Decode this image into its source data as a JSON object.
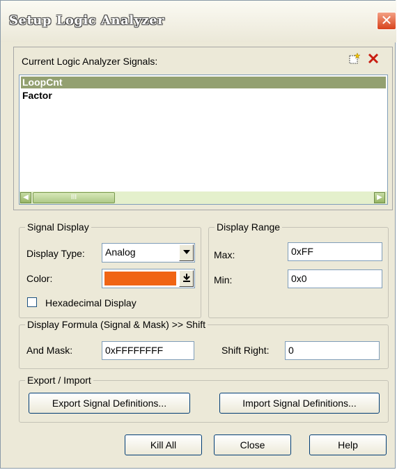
{
  "window": {
    "title": "Setup Logic Analyzer",
    "close_glyph": "✕"
  },
  "signals": {
    "label": "Current Logic Analyzer Signals:",
    "items": [
      "LoopCnt",
      "Factor"
    ],
    "selected_index": 0,
    "new_icon": "new-signal-icon",
    "delete_icon": "delete-signal-icon",
    "scroll_thumb_glyph": "III",
    "scroll_left_glyph": "◀",
    "scroll_right_glyph": "▶"
  },
  "signal_display": {
    "title": "Signal Display",
    "display_type_label": "Display Type:",
    "display_type_value": "Analog",
    "color_label": "Color:",
    "color_value": "#f06414",
    "hex_label": "Hexadecimal Display",
    "hex_checked": false
  },
  "display_range": {
    "title": "Display Range",
    "max_label": "Max:",
    "max_value": "0xFF",
    "min_label": "Min:",
    "min_value": "0x0"
  },
  "formula": {
    "title": "Display Formula (Signal & Mask) >> Shift",
    "and_mask_label": "And Mask:",
    "and_mask_value": "0xFFFFFFFF",
    "shift_right_label": "Shift Right:",
    "shift_right_value": "0"
  },
  "export_import": {
    "title": "Export / Import",
    "export_label": "Export Signal Definitions...",
    "import_label": "Import Signal Definitions..."
  },
  "buttons": {
    "kill_all": "Kill All",
    "close": "Close",
    "help": "Help"
  }
}
